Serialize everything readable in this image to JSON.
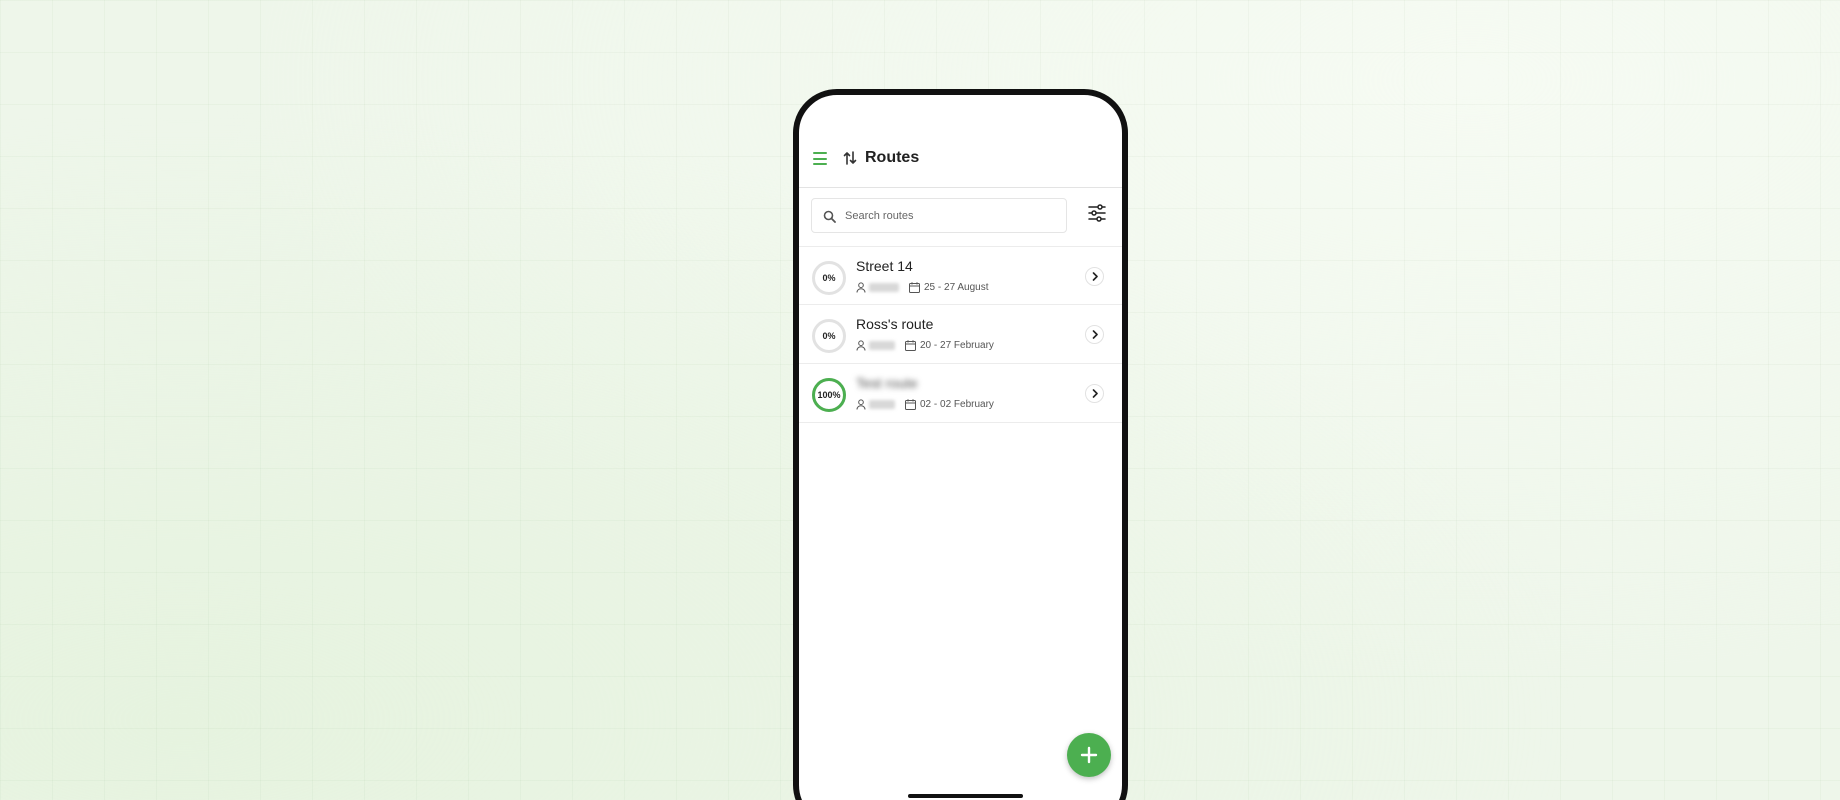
{
  "header": {
    "title": "Routes"
  },
  "search": {
    "placeholder": "Search routes",
    "value": ""
  },
  "colors": {
    "accent": "#4caf50",
    "ring_empty": "#e2e2e2"
  },
  "routes": [
    {
      "name": "Street 14",
      "progress_label": "0%",
      "progress": 0,
      "dates": "25 - 27 August",
      "name_blurred": false
    },
    {
      "name": "Ross's route",
      "progress_label": "0%",
      "progress": 0,
      "dates": "20 - 27 February",
      "name_blurred": false
    },
    {
      "name": "Test route",
      "progress_label": "100%",
      "progress": 1,
      "dates": "02 - 02 February",
      "name_blurred": true
    }
  ],
  "icons": {
    "menu": "menu-icon",
    "route": "route-icon",
    "search": "search-icon",
    "filter": "filter-icon",
    "user": "user-icon",
    "calendar": "calendar-icon",
    "chevron": "chevron-right-icon",
    "add": "plus-icon"
  }
}
